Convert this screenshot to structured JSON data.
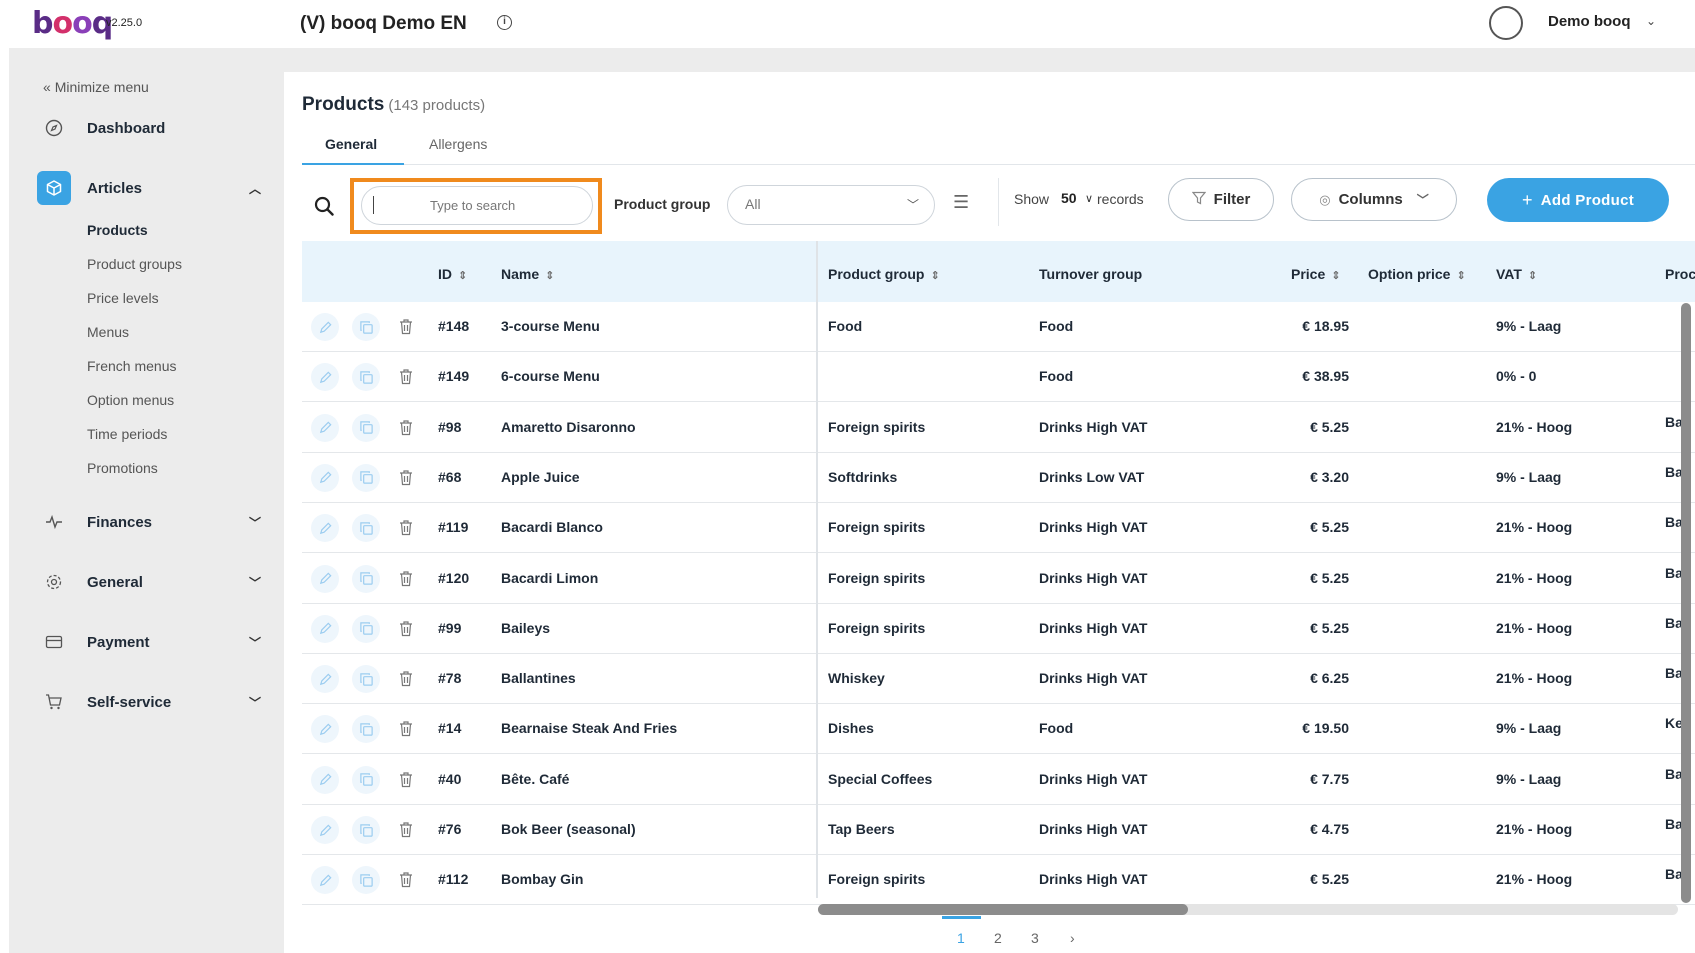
{
  "header": {
    "logo": "booq",
    "version": "v2.25.0",
    "venue": "(V) booq Demo EN",
    "user": "Demo booq"
  },
  "sidebar": {
    "minimize": "Minimize menu",
    "items": [
      {
        "label": "Dashboard",
        "icon": "compass-icon"
      },
      {
        "label": "Articles",
        "icon": "box-icon"
      },
      {
        "label": "Finances",
        "icon": "activity-icon"
      },
      {
        "label": "General",
        "icon": "gear-icon"
      },
      {
        "label": "Payment",
        "icon": "card-icon"
      },
      {
        "label": "Self-service",
        "icon": "cart-icon"
      }
    ],
    "articles_sub": [
      "Products",
      "Product groups",
      "Price levels",
      "Menus",
      "French menus",
      "Option menus",
      "Time periods",
      "Promotions"
    ]
  },
  "page": {
    "title": "Products",
    "count": "(143 products)",
    "tabs": [
      "General",
      "Allergens"
    ]
  },
  "toolbar": {
    "search_placeholder": "Type to search",
    "product_group_label": "Product group",
    "product_group_value": "All",
    "show_label": "Show",
    "show_value": "50",
    "records_label": "records",
    "filter_label": "Filter",
    "columns_label": "Columns",
    "add_label": "Add Product"
  },
  "table": {
    "headers": [
      "ID",
      "Name",
      "Product group",
      "Turnover group",
      "Price",
      "Option price",
      "VAT",
      "Proc"
    ],
    "rows": [
      {
        "id": "#148",
        "name": "3-course Menu",
        "group": "Food",
        "turnover": "Food",
        "price": "€ 18.95",
        "vat": "9% - Laag",
        "extra": ""
      },
      {
        "id": "#149",
        "name": "6-course Menu",
        "group": "",
        "turnover": "Food",
        "price": "€ 38.95",
        "vat": "0% - 0",
        "extra": ""
      },
      {
        "id": "#98",
        "name": "Amaretto Disaronno",
        "group": "Foreign spirits",
        "turnover": "Drinks High VAT",
        "price": "€ 5.25",
        "vat": "21% - Hoog",
        "extra": "Ba"
      },
      {
        "id": "#68",
        "name": "Apple Juice",
        "group": "Softdrinks",
        "turnover": "Drinks Low VAT",
        "price": "€ 3.20",
        "vat": "9% - Laag",
        "extra": "Ba"
      },
      {
        "id": "#119",
        "name": "Bacardi Blanco",
        "group": "Foreign spirits",
        "turnover": "Drinks High VAT",
        "price": "€ 5.25",
        "vat": "21% - Hoog",
        "extra": "Ba"
      },
      {
        "id": "#120",
        "name": "Bacardi Limon",
        "group": "Foreign spirits",
        "turnover": "Drinks High VAT",
        "price": "€ 5.25",
        "vat": "21% - Hoog",
        "extra": "Ba"
      },
      {
        "id": "#99",
        "name": "Baileys",
        "group": "Foreign spirits",
        "turnover": "Drinks High VAT",
        "price": "€ 5.25",
        "vat": "21% - Hoog",
        "extra": "Ba"
      },
      {
        "id": "#78",
        "name": "Ballantines",
        "group": "Whiskey",
        "turnover": "Drinks High VAT",
        "price": "€ 6.25",
        "vat": "21% - Hoog",
        "extra": "Ba"
      },
      {
        "id": "#14",
        "name": "Bearnaise Steak And Fries",
        "group": "Dishes",
        "turnover": "Food",
        "price": "€ 19.50",
        "vat": "9% - Laag",
        "extra": "Ke"
      },
      {
        "id": "#40",
        "name": "Bête. Café",
        "group": "Special Coffees",
        "turnover": "Drinks High VAT",
        "price": "€ 7.75",
        "vat": "9% - Laag",
        "extra": "Ba"
      },
      {
        "id": "#76",
        "name": "Bok Beer (seasonal)",
        "group": "Tap Beers",
        "turnover": "Drinks High VAT",
        "price": "€ 4.75",
        "vat": "21% - Hoog",
        "extra": "Ba"
      },
      {
        "id": "#112",
        "name": "Bombay Gin",
        "group": "Foreign spirits",
        "turnover": "Drinks High VAT",
        "price": "€ 5.25",
        "vat": "21% - Hoog",
        "extra": "Ba"
      }
    ]
  },
  "pagination": [
    "1",
    "2",
    "3",
    "›"
  ],
  "colors": {
    "accent": "#3aa3e3",
    "highlight": "#f08a1d"
  }
}
